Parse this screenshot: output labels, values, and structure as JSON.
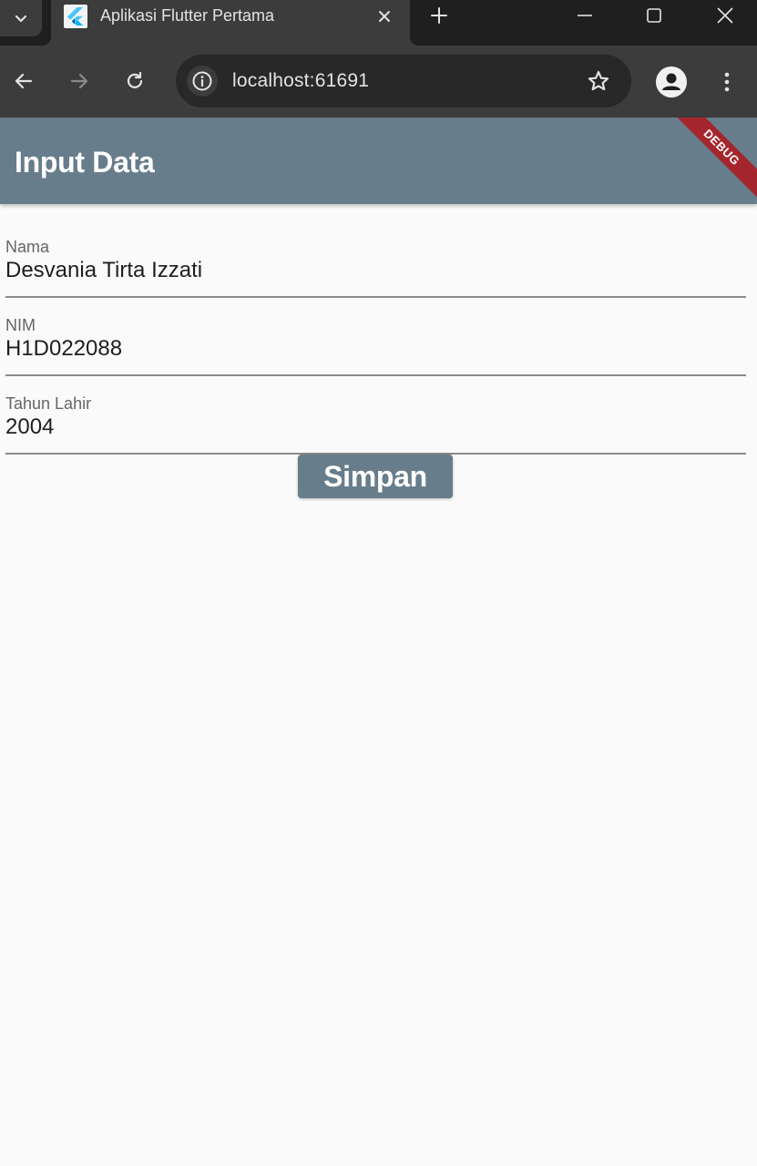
{
  "browser": {
    "tab": {
      "title": "Aplikasi Flutter Pertama",
      "favicon": "flutter-logo-icon"
    },
    "address": {
      "url": "localhost:61691"
    },
    "colors": {
      "tabbar": "#1f1f1f",
      "toolbar": "#3c3c3c",
      "omnibox": "#282828"
    }
  },
  "app": {
    "appbar": {
      "title": "Input Data",
      "debug_banner": "DEBUG",
      "color": "#677d8b"
    },
    "form": {
      "fields": [
        {
          "label": "Nama",
          "value": "Desvania Tirta Izzati"
        },
        {
          "label": "NIM",
          "value": "H1D022088"
        },
        {
          "label": "Tahun Lahir",
          "value": "2004"
        }
      ],
      "submit_label": "Simpan"
    }
  }
}
